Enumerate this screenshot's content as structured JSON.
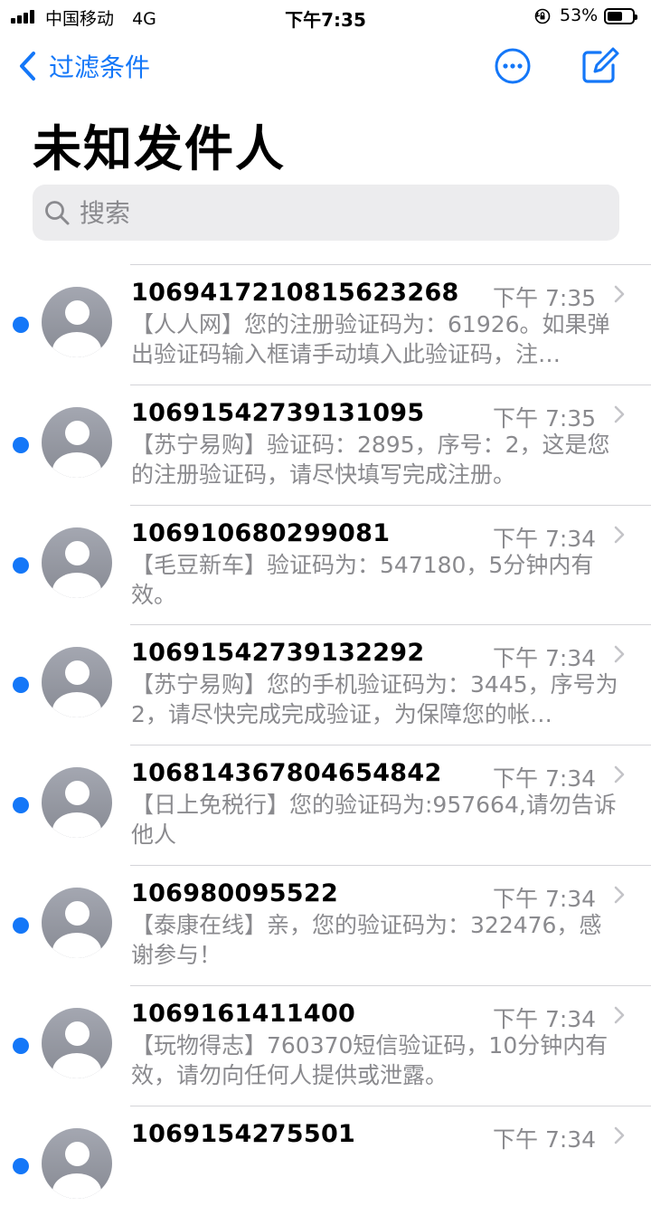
{
  "status_bar": {
    "carrier": "中国移动",
    "network": "4G",
    "time": "下午7:35",
    "battery": "53%"
  },
  "nav": {
    "back_label": "过滤条件"
  },
  "page": {
    "title": "未知发件人"
  },
  "search": {
    "placeholder": "搜索"
  },
  "messages": [
    {
      "sender": "1069417210815623268",
      "time": "下午 7:35",
      "preview": "【人人网】您的注册验证码为：61926。如果弹出验证码输入框请手动填入此验证码，注…"
    },
    {
      "sender": "10691542739131095",
      "time": "下午 7:35",
      "preview": "【苏宁易购】验证码：2895，序号：2，这是您的注册验证码，请尽快填写完成注册。"
    },
    {
      "sender": "106910680299081",
      "time": "下午 7:34",
      "preview": "【毛豆新车】验证码为：547180，5分钟内有效。"
    },
    {
      "sender": "10691542739132292",
      "time": "下午 7:34",
      "preview": "【苏宁易购】您的手机验证码为：3445，序号为2，请尽快完成完成验证，为保障您的帐…"
    },
    {
      "sender": "106814367804654842",
      "time": "下午 7:34",
      "preview": "【日上免税行】您的验证码为:957664,请勿告诉他人"
    },
    {
      "sender": "106980095522",
      "time": "下午 7:34",
      "preview": "【泰康在线】亲，您的验证码为：322476，感谢参与！"
    },
    {
      "sender": "1069161411400",
      "time": "下午 7:34",
      "preview": "【玩物得志】760370短信验证码，10分钟内有效，请勿向任何人提供或泄露。"
    },
    {
      "sender": "1069154275501",
      "time": "下午 7:34",
      "preview": ""
    }
  ],
  "colors": {
    "accent": "#1477f8",
    "secondary_text": "#8a8a8e",
    "search_bg": "#ececee"
  }
}
